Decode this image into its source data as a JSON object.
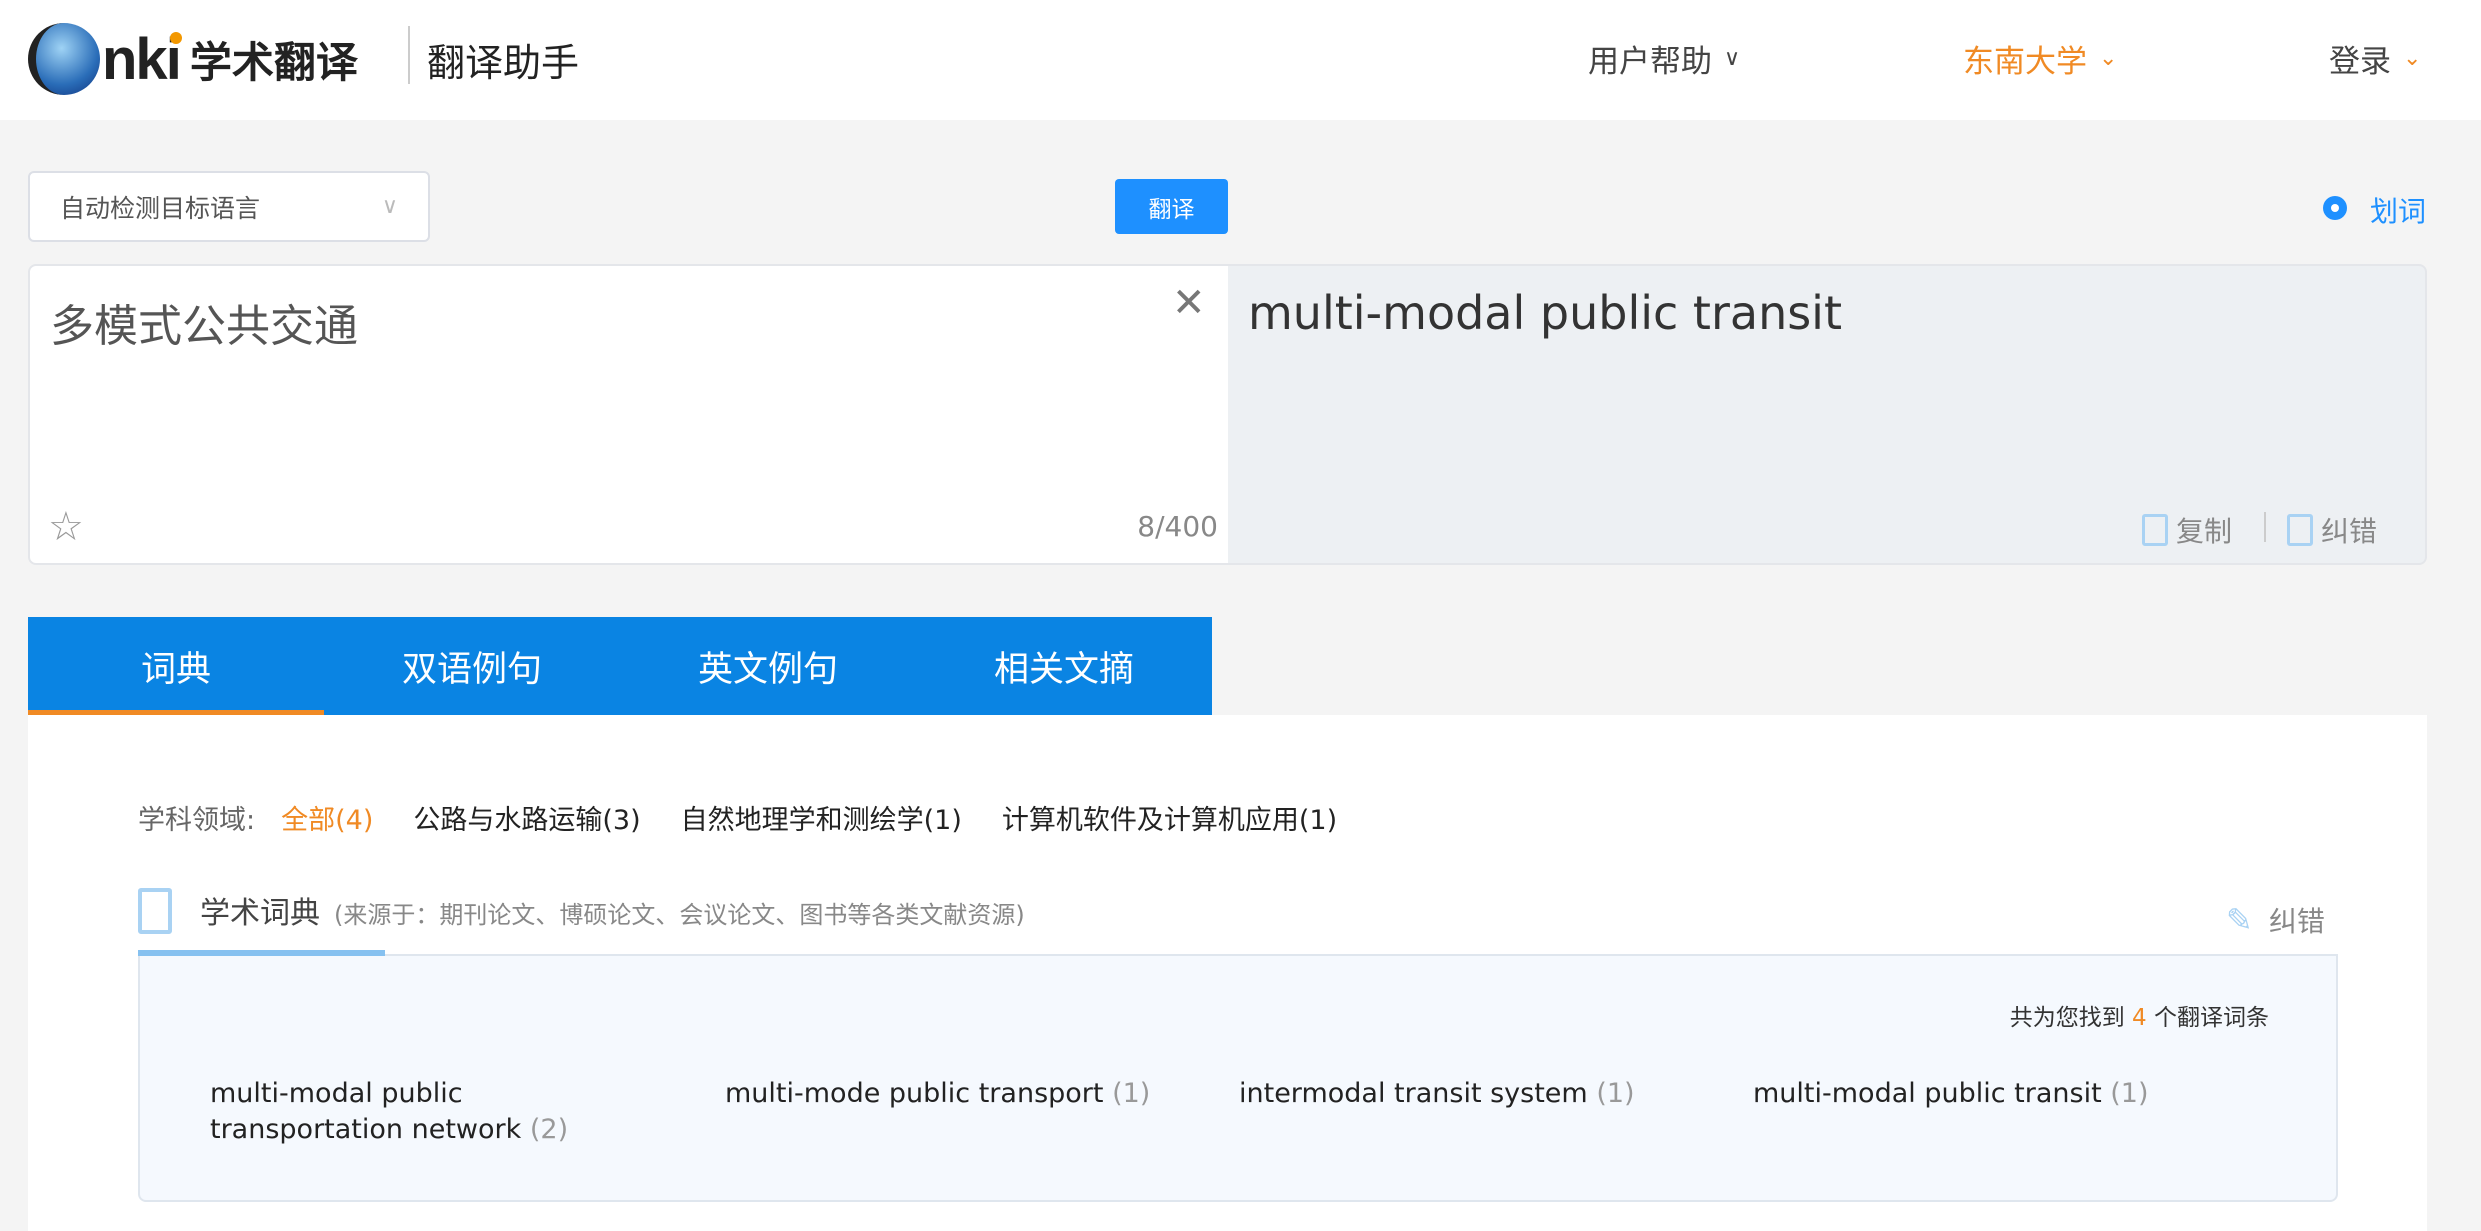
{
  "header": {
    "logo_text": "学术翻译",
    "logo_brand": "CNKI",
    "subtitle": "翻译助手",
    "nav": [
      {
        "label": "用户帮助"
      },
      {
        "label": "东南大学"
      },
      {
        "label": "登录"
      }
    ],
    "accent": "#f08a24"
  },
  "toolbar": {
    "language_select": "自动检测目标语言",
    "translate_button": "翻译",
    "word_select_label": "划词"
  },
  "input": {
    "text": "多模式公共交通",
    "char_count": "8/400"
  },
  "output": {
    "text": "multi-modal public transit",
    "copy_label": "复制",
    "report_label": "纠错"
  },
  "tabs": [
    {
      "label": "词典"
    },
    {
      "label": "双语例句"
    },
    {
      "label": "英文例句"
    },
    {
      "label": "相关文摘"
    }
  ],
  "filters": {
    "label": "学科领域:",
    "items": [
      "全部(4)",
      "公路与水路运输(3)",
      "自然地理学和测绘学(1)",
      "计算机软件及计算机应用(1)"
    ]
  },
  "dictionary": {
    "title": "学术词典",
    "source": "(来源于：期刊论文、博硕论文、会议论文、图书等各类文献资源)",
    "report_label": "纠错",
    "found_prefix": "共为您找到",
    "found_count": "4",
    "found_suffix": "个翻译词条",
    "entries": [
      {
        "term": "multi-modal public transportation network",
        "count": "(2)"
      },
      {
        "term": "multi-mode public transport",
        "count": "(1)"
      },
      {
        "term": "intermodal transit system",
        "count": "(1)"
      },
      {
        "term": "multi-modal public transit",
        "count": "(1)"
      }
    ]
  }
}
